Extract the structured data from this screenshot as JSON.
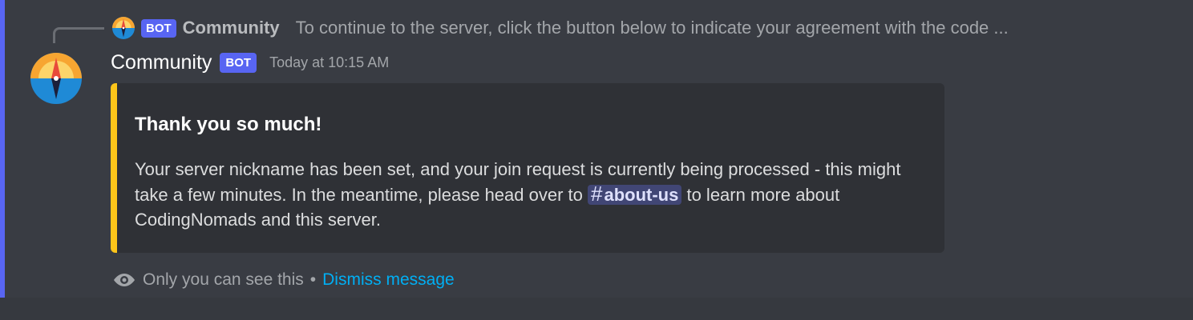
{
  "reply": {
    "bot_tag": "BOT",
    "author": "Community",
    "preview": "To continue to the server, click the button below to indicate your agreement with the code ..."
  },
  "message": {
    "author": "Community",
    "bot_tag": "BOT",
    "timestamp": "Today at 10:15 AM",
    "avatar_icon": "compass-icon"
  },
  "embed": {
    "accent_color": "#fdc51a",
    "title": "Thank you so much!",
    "desc_part1": "Your server nickname has been set, and your join request is currently being processed - this might take a few minutes. In the meantime, please head over to ",
    "channel_hash": "#",
    "channel_name": "about-us",
    "desc_part2": " to learn more about CodingNomads and this server."
  },
  "ephemeral": {
    "notice": "Only you can see this",
    "separator": "•",
    "dismiss_label": "Dismiss message"
  },
  "colors": {
    "background": "#36393f",
    "highlight": "#5865f2",
    "link": "#00aff4"
  }
}
